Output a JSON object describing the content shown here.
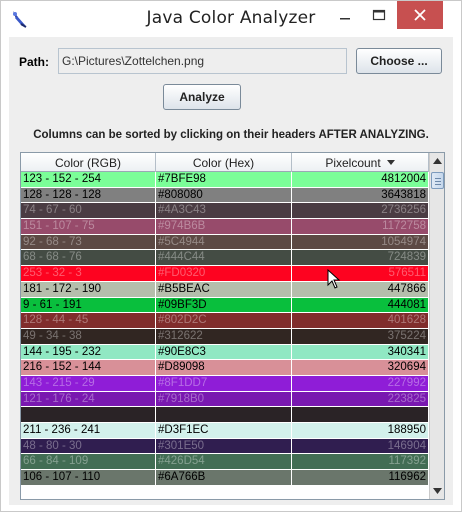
{
  "window": {
    "title": "Java Color Analyzer"
  },
  "path": {
    "label": "Path:",
    "value": "G:\\Pictures\\Zottelchen.png"
  },
  "buttons": {
    "choose": "Choose ...",
    "analyze": "Analyze"
  },
  "hint": "Columns can be sorted by clicking on their headers AFTER ANALYZING.",
  "table": {
    "headers": [
      "Color (RGB)",
      "Color (Hex)",
      "Pixelcount"
    ],
    "sort_column": "Pixelcount",
    "sort_direction": "descending",
    "rows": [
      {
        "rgb": "123 - 152 - 254",
        "hex": "#7BFE98",
        "count": "4812004",
        "bg": "#7BFE98"
      },
      {
        "rgb": "128 - 128 - 128",
        "hex": "#808080",
        "count": "3643818",
        "bg": "#808080"
      },
      {
        "rgb": "74 - 67 - 60",
        "hex": "#4A3C43",
        "count": "2736256",
        "bg": "#4A3C43"
      },
      {
        "rgb": "151 - 107 - 75",
        "hex": "#974B6B",
        "count": "1172758",
        "bg": "#974B6B"
      },
      {
        "rgb": "92 - 68 - 73",
        "hex": "#5C4944",
        "count": "1054974",
        "bg": "#5C4944"
      },
      {
        "rgb": "68 - 68 - 76",
        "hex": "#444C44",
        "count": "724839",
        "bg": "#444C44"
      },
      {
        "rgb": "253 - 32 - 3",
        "hex": "#FD0320",
        "count": "576511",
        "bg": "#FD0320"
      },
      {
        "rgb": "181 - 172 - 190",
        "hex": "#B5BEAC",
        "count": "447866",
        "bg": "#B5BEAC"
      },
      {
        "rgb": "9 - 61 - 191",
        "hex": "#09BF3D",
        "count": "444081",
        "bg": "#09BF3D"
      },
      {
        "rgb": "128 - 44 - 45",
        "hex": "#802D2C",
        "count": "401628",
        "bg": "#802D2C"
      },
      {
        "rgb": "49 - 34 - 38",
        "hex": "#312622",
        "count": "375224",
        "bg": "#312622"
      },
      {
        "rgb": "144 - 195 - 232",
        "hex": "#90E8C3",
        "count": "340341",
        "bg": "#90E8C3"
      },
      {
        "rgb": "216 - 152 - 144",
        "hex": "#D89098",
        "count": "320694",
        "bg": "#D89098"
      },
      {
        "rgb": "143 - 215 - 29",
        "hex": "#8F1DD7",
        "count": "227992",
        "bg": "#8F1DD7"
      },
      {
        "rgb": "121 - 176 - 24",
        "hex": "#7918B0",
        "count": "223825",
        "bg": "#7918B0"
      },
      {
        "rgb": "",
        "hex": "",
        "count": "",
        "bg": "#2A2326"
      },
      {
        "rgb": "211 - 236 - 241",
        "hex": "#D3F1EC",
        "count": "188950",
        "bg": "#D3F1EC"
      },
      {
        "rgb": "48 - 80 - 30",
        "hex": "#301E50",
        "count": "146904",
        "bg": "#301E50"
      },
      {
        "rgb": "66 - 84 - 109",
        "hex": "#426D54",
        "count": "117392",
        "bg": "#426D54"
      },
      {
        "rgb": "106 - 107 - 110",
        "hex": "#6A766B",
        "count": "116962",
        "bg": "#6A766B"
      }
    ]
  },
  "colors": {
    "close_button": "#C75050",
    "content_bg": "#EEEEEE",
    "title_icon": "#2A3F9B"
  }
}
